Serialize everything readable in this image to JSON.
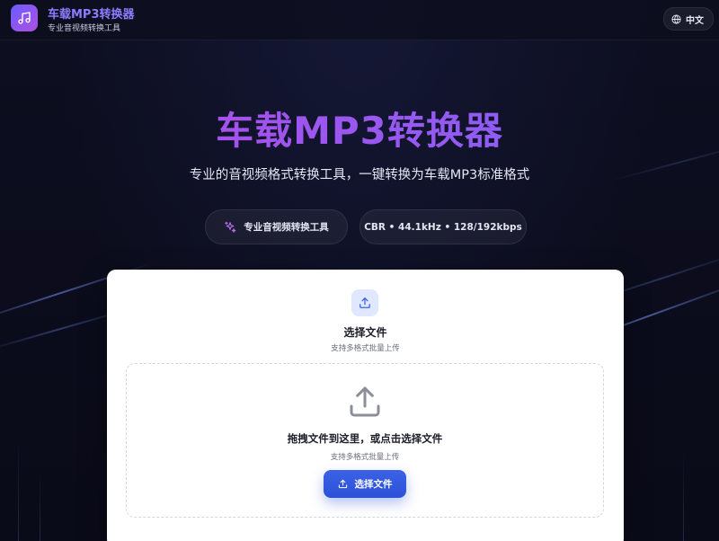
{
  "header": {
    "app_title": "车载MP3转换器",
    "app_subtitle": "专业音视频转换工具",
    "language_label": "中文"
  },
  "hero": {
    "title": "车载MP3转换器",
    "subtitle": "专业的音视频格式转换工具，一键转换为车载MP3标准格式",
    "badges": [
      {
        "label": "专业音视频转换工具",
        "icon": "sparkles-icon"
      },
      {
        "label": "CBR • 44.1kHz • 128/192kbps"
      }
    ]
  },
  "upload": {
    "title": "选择文件",
    "subtitle": "支持多格式批量上传",
    "dropzone_title": "拖拽文件到这里，或点击选择文件",
    "dropzone_subtitle": "支持多格式批量上传",
    "button_label": "选择文件"
  },
  "colors": {
    "accent": "#2c51d6",
    "title_gradient_start": "#b44be4",
    "title_gradient_end": "#7f63f7",
    "background": "#0b0c1a"
  }
}
